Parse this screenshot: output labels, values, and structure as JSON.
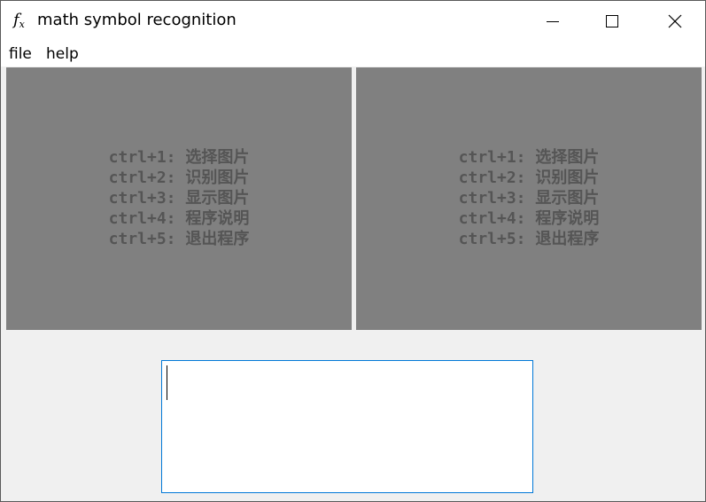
{
  "window": {
    "title": "math symbol recognition",
    "icon": "fx-icon",
    "controls": [
      "minimize-icon",
      "maximize-icon",
      "close-icon"
    ]
  },
  "menu": {
    "file": "file",
    "help": "help"
  },
  "panels": {
    "left": {
      "lines": [
        "ctrl+1: 选择图片",
        "ctrl+2: 识别图片",
        "ctrl+3: 显示图片",
        "ctrl+4: 程序说明",
        "ctrl+5: 退出程序"
      ]
    },
    "right": {
      "lines": [
        "ctrl+1: 选择图片",
        "ctrl+2: 识别图片",
        "ctrl+3: 显示图片",
        "ctrl+4: 程序说明",
        "ctrl+5: 退出程序"
      ]
    }
  },
  "result": {
    "value": ""
  },
  "colors": {
    "panel_bg": "#808080",
    "panel_text": "#555555",
    "focus_border": "#0078d7",
    "window_bg": "#f0f0f0"
  }
}
